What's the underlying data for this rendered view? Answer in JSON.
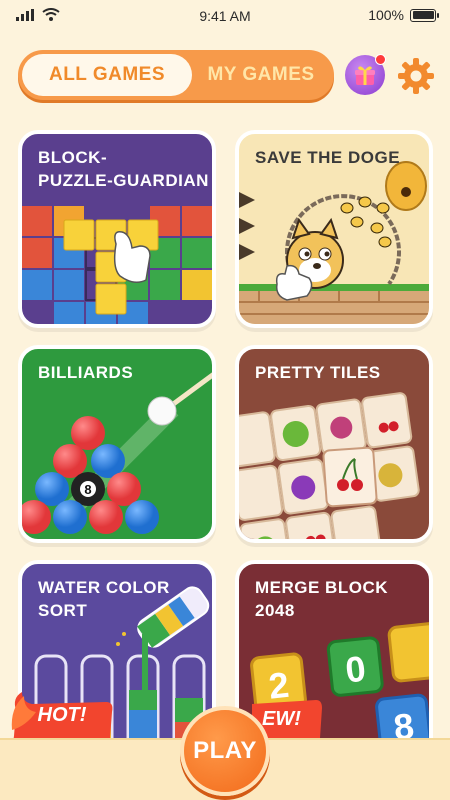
{
  "status_bar": {
    "time": "9:41 AM",
    "battery": "100%"
  },
  "tabs": {
    "all_games": "ALL GAMES",
    "my_games": "MY GAMES",
    "active": "ALL GAMES"
  },
  "header_icons": {
    "gift": "gift-icon",
    "settings": "gear-icon"
  },
  "games": [
    {
      "title_line1": "BLOCK-",
      "title_line2": "PUZZLE-GUARDIAN"
    },
    {
      "title_line1": "SAVE THE DOGE"
    },
    {
      "title_line1": "BILLIARDS",
      "ball_number": "8"
    },
    {
      "title_line1": "PRETTY TILES"
    },
    {
      "title_line1": "WATER COLOR",
      "title_line2": "SORT"
    },
    {
      "title_line1": "MERGE BLOCK",
      "title_line2": "2048",
      "tiles": [
        "2",
        "0",
        "2",
        "8"
      ]
    }
  ],
  "badges": {
    "hot": "HOT!",
    "new": "EW!"
  },
  "play_button": "PLAY",
  "colors": {
    "accent": "#f79a4a",
    "play": "#f26a1a",
    "background": "#fdf3dc"
  }
}
